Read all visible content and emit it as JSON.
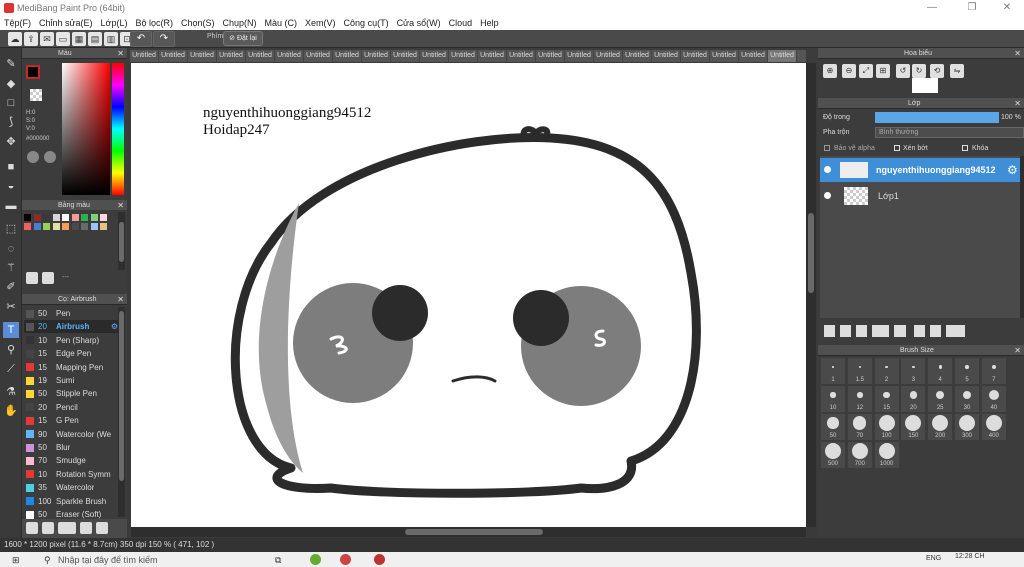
{
  "window": {
    "title": "MediBang Paint Pro (64bit)",
    "min": "—",
    "max": "❐",
    "close": "✕"
  },
  "menu": [
    "Tệp(F)",
    "Chỉnh sửa(E)",
    "Lớp(L)",
    "Bộ lọc(R)",
    "Chọn(S)",
    "Chụp(N)",
    "Màu (C)",
    "Xem(V)",
    "Công cụ(T)",
    "Cửa sổ(W)",
    "Cloud",
    "Help"
  ],
  "toolbar": {
    "phim": "Phím",
    "reset": "Đặt lại"
  },
  "color_panel": {
    "title": "Màu",
    "h": "H:0",
    "s": "S:0",
    "v": "V:0",
    "hex": "#000000",
    "accent": "#c62828"
  },
  "palette_panel": {
    "title": "Bảng màu",
    "dots": "---",
    "colors": [
      "#000000",
      "#8b2b2b",
      "#3a3a3a",
      "#d6d6d6",
      "#ffffff",
      "#f39a9a",
      "#2fb04a",
      "#7fd17f",
      "#ffd6e0",
      "#f06060",
      "#4a7fd0",
      "#9ad055",
      "#e0e0a0",
      "#f59a59",
      "#4a4a4a",
      "#6a6a6a",
      "#a0c0ff",
      "#e8c080"
    ]
  },
  "brush_panel": {
    "title": "Cọ: Airbrush",
    "items": [
      {
        "size": "50",
        "name": "Pen",
        "color": "#555555"
      },
      {
        "size": "20",
        "name": "Airbrush",
        "color": "#555555",
        "selected": true
      },
      {
        "size": "10",
        "name": "Pen (Sharp)",
        "color": "#333333"
      },
      {
        "size": "15",
        "name": "Edge Pen",
        "color": "#444444"
      },
      {
        "size": "15",
        "name": "Mapping Pen",
        "color": "#e53935"
      },
      {
        "size": "19",
        "name": "Sumi",
        "color": "#fdd835"
      },
      {
        "size": "50",
        "name": "Stipple Pen",
        "color": "#fdd835"
      },
      {
        "size": "20",
        "name": "Pencil",
        "color": "#444444"
      },
      {
        "size": "15",
        "name": "G Pen",
        "color": "#e53935"
      },
      {
        "size": "90",
        "name": "Watercolor (We",
        "color": "#64b5f6"
      },
      {
        "size": "50",
        "name": "Blur",
        "color": "#ce93d8"
      },
      {
        "size": "70",
        "name": "Smudge",
        "color": "#f8bbd0"
      },
      {
        "size": "10",
        "name": "Rotation Symm",
        "color": "#e53935"
      },
      {
        "size": "35",
        "name": "Watercolor",
        "color": "#4dd0e1"
      },
      {
        "size": "100",
        "name": "Sparkle Brush",
        "color": "#1e88e5"
      },
      {
        "size": "50",
        "name": "Eraser (Soft)",
        "color": "#ffffff"
      }
    ]
  },
  "tabs": [
    "Untitled",
    "Untitled",
    "Untitled",
    "Untitled",
    "Untitled",
    "Untitled",
    "Untitled",
    "Untitled",
    "Untitled",
    "Untitled",
    "Untitled",
    "Untitled",
    "Untitled",
    "Untitled",
    "Untitled",
    "Untitled",
    "Untitled",
    "Untitled",
    "Untitled",
    "Untitled",
    "Untitled",
    "Untitled",
    "Untitled"
  ],
  "canvas": {
    "line1": "nguyenthihuonggiang94512",
    "line2": "Hoidap247"
  },
  "navigator": {
    "title": "Hoa biểu"
  },
  "layer_panel": {
    "title": "Lớp",
    "opacity_label": "Độ trong",
    "opacity_value": "100 %",
    "opacity_fraction": 1.0,
    "blend_label": "Pha trộn",
    "blend_value": "Bình thường",
    "protect_alpha": "Bảo vệ alpha",
    "clipping": "Xén bớt",
    "lock": "Khóa",
    "layers": [
      {
        "name": "nguyenthihuonggiang94512",
        "selected": true
      },
      {
        "name": "Lớp1",
        "selected": false
      }
    ]
  },
  "brush_size": {
    "title": "Brush Size",
    "sizes": [
      "1",
      "1.5",
      "2",
      "3",
      "4",
      "5",
      "7",
      "10",
      "12",
      "15",
      "20",
      "25",
      "30",
      "40",
      "50",
      "70",
      "100",
      "150",
      "200",
      "300",
      "400",
      "500",
      "700",
      "1000"
    ]
  },
  "status": "1600 * 1200 pixel   (11.6 * 8.7cm)   350 dpi   150 %   ( 471, 102 )",
  "taskbar": {
    "search": "Nhập tại đây để tìm kiếm",
    "time": "12:28 CH",
    "lang": "ENG"
  }
}
